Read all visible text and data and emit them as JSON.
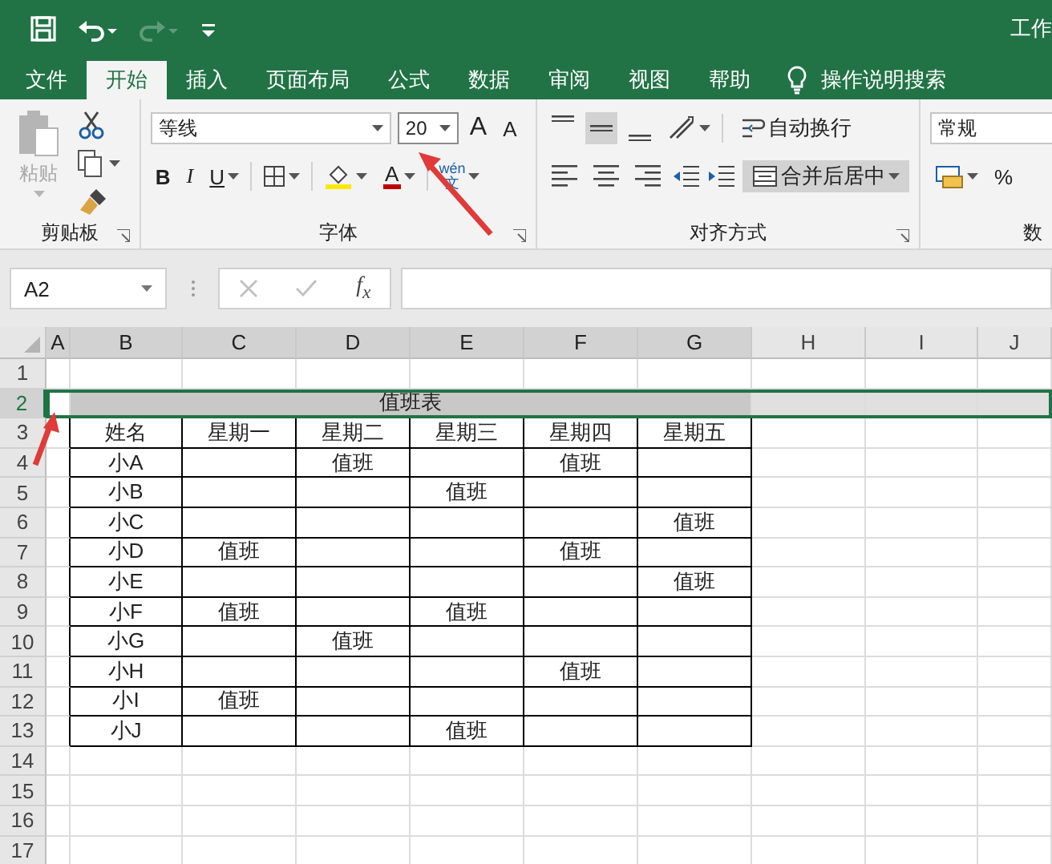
{
  "title_bar": {
    "title": "工作",
    "quick_access": [
      {
        "kind": "save",
        "disabled": false
      },
      {
        "kind": "undo",
        "disabled": false
      },
      {
        "kind": "redo",
        "disabled": true
      },
      {
        "kind": "customize",
        "disabled": false
      }
    ]
  },
  "menu_tabs": [
    {
      "label": "文件",
      "selected": false
    },
    {
      "label": "开始",
      "selected": true
    },
    {
      "label": "插入",
      "selected": false
    },
    {
      "label": "页面布局",
      "selected": false
    },
    {
      "label": "公式",
      "selected": false
    },
    {
      "label": "数据",
      "selected": false
    },
    {
      "label": "审阅",
      "selected": false
    },
    {
      "label": "视图",
      "selected": false
    },
    {
      "label": "帮助",
      "selected": false
    }
  ],
  "tell_me": "操作说明搜索",
  "ribbon": {
    "clipboard": {
      "label": "剪贴板",
      "paste": "粘贴",
      "paste_disabled": true
    },
    "font": {
      "label": "字体",
      "font_name": "等线",
      "size_value": "20",
      "grow_font": "A",
      "shrink_font": "A",
      "bold": "B",
      "italic": "I",
      "underline": "U",
      "font_color": "A",
      "phonetic_top": "wén",
      "phonetic_bottom": "文"
    },
    "alignment": {
      "label": "对齐方式",
      "vertical": [
        {
          "kind": "top",
          "selected": false
        },
        {
          "kind": "middle",
          "selected": true
        },
        {
          "kind": "bottom",
          "selected": false
        }
      ],
      "horizontal": [
        {
          "kind": "left",
          "selected": false
        },
        {
          "kind": "center",
          "selected": false
        },
        {
          "kind": "right",
          "selected": false
        }
      ],
      "wrap_text": "自动换行",
      "merge_center": "合并后居中",
      "merge_selected": true
    },
    "number": {
      "label": "数",
      "format": "常规",
      "percent": "%"
    }
  },
  "formula_bar": {
    "name_box": "A2",
    "function": "f$_{x}$"
  },
  "sheet": {
    "columns": [
      {
        "label": "A",
        "selected": true
      },
      {
        "label": "B",
        "selected": true
      },
      {
        "label": "C",
        "selected": true
      },
      {
        "label": "D",
        "selected": true
      },
      {
        "label": "E",
        "selected": true
      },
      {
        "label": "F",
        "selected": true
      },
      {
        "label": "G",
        "selected": true
      },
      {
        "label": "H",
        "selected": false
      },
      {
        "label": "I",
        "selected": false
      },
      {
        "label": "J",
        "selected": false
      }
    ],
    "rows": [
      {
        "label": "1",
        "selected": false
      },
      {
        "label": "2",
        "selected": true
      },
      {
        "label": "3",
        "selected": false
      },
      {
        "label": "4",
        "selected": false
      },
      {
        "label": "5",
        "selected": false
      },
      {
        "label": "6",
        "selected": false
      },
      {
        "label": "7",
        "selected": false
      },
      {
        "label": "8",
        "selected": false
      },
      {
        "label": "9",
        "selected": false
      },
      {
        "label": "10",
        "selected": false
      },
      {
        "label": "11",
        "selected": false
      },
      {
        "label": "12",
        "selected": false
      },
      {
        "label": "13",
        "selected": false
      },
      {
        "label": "14",
        "selected": false
      },
      {
        "label": "15",
        "selected": false
      },
      {
        "label": "16",
        "selected": false
      },
      {
        "label": "17",
        "selected": false
      }
    ],
    "title_cell": "值班表",
    "table": {
      "header": [
        "姓名",
        "星期一",
        "星期二",
        "星期三",
        "星期四",
        "星期五"
      ],
      "rows": [
        [
          "小A",
          null,
          "值班",
          null,
          "值班",
          null
        ],
        [
          "小B",
          null,
          null,
          "值班",
          null,
          null
        ],
        [
          "小C",
          null,
          null,
          null,
          null,
          "值班"
        ],
        [
          "小D",
          "值班",
          null,
          null,
          "值班",
          null
        ],
        [
          "小E",
          null,
          null,
          null,
          null,
          "值班"
        ],
        [
          "小F",
          "值班",
          null,
          "值班",
          null,
          null
        ],
        [
          "小G",
          null,
          "值班",
          null,
          null,
          null
        ],
        [
          "小H",
          null,
          null,
          null,
          "值班",
          null
        ],
        [
          "小I",
          "值班",
          null,
          null,
          null,
          null
        ],
        [
          "小J",
          null,
          null,
          "值班",
          null,
          null
        ]
      ]
    }
  }
}
